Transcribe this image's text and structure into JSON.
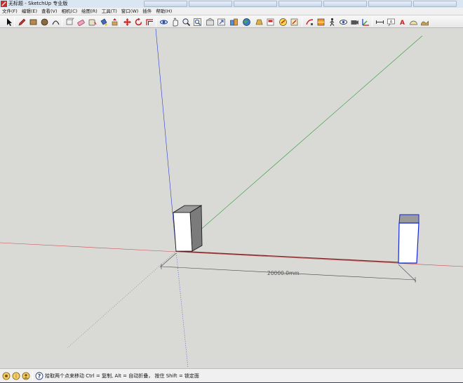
{
  "window": {
    "title": "无标题 - SketchUp 专业版"
  },
  "menu": {
    "items": [
      {
        "key": "file",
        "label": "文件(F)"
      },
      {
        "key": "edit",
        "label": "编辑(E)"
      },
      {
        "key": "view",
        "label": "查看(V)"
      },
      {
        "key": "camera",
        "label": "相机(C)"
      },
      {
        "key": "draw",
        "label": "绘图(R)"
      },
      {
        "key": "tools",
        "label": "工具(T)"
      },
      {
        "key": "window",
        "label": "窗口(W)"
      },
      {
        "key": "plugins",
        "label": "插件"
      },
      {
        "key": "help",
        "label": "帮助(H)"
      }
    ]
  },
  "toolbar": {
    "buttons": [
      {
        "name": "select-tool-icon",
        "glyph": "arrow"
      },
      {
        "name": "line-tool-icon",
        "glyph": "pencil"
      },
      {
        "name": "rectangle-tool-icon",
        "glyph": "rect"
      },
      {
        "name": "circle-tool-icon",
        "glyph": "circle"
      },
      {
        "name": "arc-tool-icon",
        "glyph": "arc"
      },
      {
        "name": "make-component-icon",
        "glyph": "component"
      },
      {
        "name": "eraser-tool-icon",
        "glyph": "eraser"
      },
      {
        "name": "tape-measure-icon",
        "glyph": "tape"
      },
      {
        "name": "paint-bucket-icon",
        "glyph": "bucket"
      },
      {
        "name": "push-pull-icon",
        "glyph": "pushpull"
      },
      {
        "name": "move-tool-icon",
        "glyph": "move"
      },
      {
        "name": "rotate-tool-icon",
        "glyph": "rotate"
      },
      {
        "name": "offset-tool-icon",
        "glyph": "offset"
      },
      {
        "name": "orbit-tool-icon",
        "glyph": "orbit"
      },
      {
        "name": "pan-tool-icon",
        "glyph": "pan"
      },
      {
        "name": "zoom-tool-icon",
        "glyph": "zoom"
      },
      {
        "name": "zoom-extents-icon",
        "glyph": "zoomext"
      },
      {
        "name": "warehouse-icon",
        "glyph": "warehouse"
      },
      {
        "name": "share-model-icon",
        "glyph": "share"
      },
      {
        "name": "components-icon",
        "glyph": "components"
      },
      {
        "name": "google-earth-icon",
        "glyph": "earth"
      },
      {
        "name": "extension-warehouse-icon",
        "glyph": "extwarehouse"
      },
      {
        "name": "layout-icon",
        "glyph": "layout"
      },
      {
        "name": "style-builder-icon",
        "glyph": "style"
      },
      {
        "name": "scale-tool-icon",
        "glyph": "scale"
      },
      {
        "name": "follow-me-icon",
        "glyph": "follow"
      },
      {
        "name": "section-plane-icon",
        "glyph": "section"
      },
      {
        "name": "walk-tool-icon",
        "glyph": "walk"
      },
      {
        "name": "look-around-icon",
        "glyph": "look"
      },
      {
        "name": "position-camera-icon",
        "glyph": "poscam"
      },
      {
        "name": "axes-tool-icon",
        "glyph": "axes"
      },
      {
        "name": "dimension-tool-icon",
        "glyph": "dimension"
      },
      {
        "name": "text-tool-icon",
        "glyph": "text"
      },
      {
        "name": "3d-text-icon",
        "glyph": "text3d"
      },
      {
        "name": "protractor-icon",
        "glyph": "protractor"
      },
      {
        "name": "sandbox-icon",
        "glyph": "sandbox"
      }
    ]
  },
  "viewport": {
    "dimension_label": "20000.0mm",
    "colors": {
      "background": "#d9d9d5",
      "red_axis": "#c4232a",
      "green_axis": "#2e9b3a",
      "blue_axis": "#2a3fd1",
      "selection": "#1426d8",
      "edge": "#111111",
      "face_front": "#ffffff",
      "face_top": "#9a9a9a",
      "face_side": "#777777"
    }
  },
  "status": {
    "hint": "拾取两个点来移动 Ctrl = 复制, Alt = 自动折叠， 按住 Shift = 锁定面"
  }
}
